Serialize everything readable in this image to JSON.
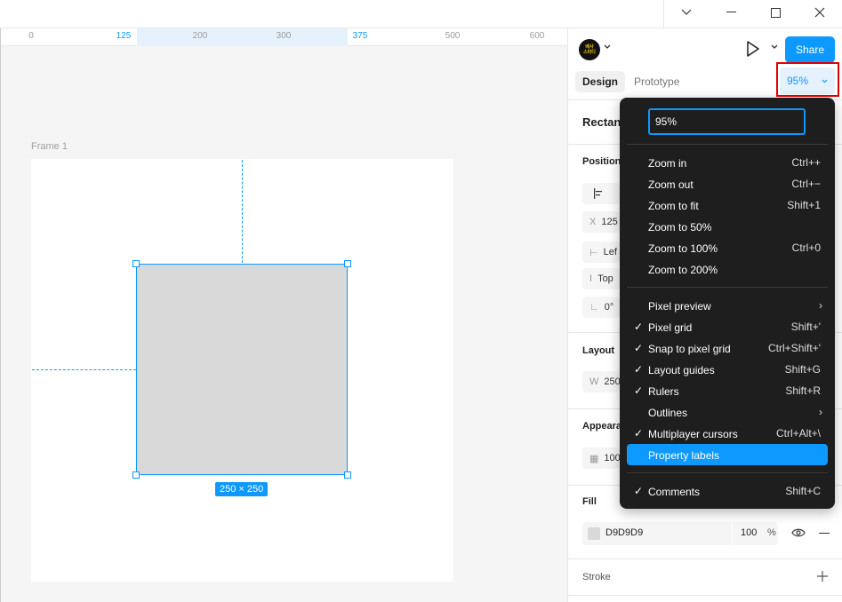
{
  "ruler": {
    "ticks": [
      {
        "label": "0",
        "selected": false
      },
      {
        "label": "125",
        "selected": true
      },
      {
        "label": "200",
        "selected": false
      },
      {
        "label": "300",
        "selected": false
      },
      {
        "label": "375",
        "selected": true
      },
      {
        "label": "500",
        "selected": false
      },
      {
        "label": "600",
        "selected": false
      }
    ]
  },
  "canvas": {
    "frame_label": "Frame 1",
    "dimensions_badge": "250 × 250"
  },
  "avatar": {
    "line1": "배사",
    "line2": "스타디"
  },
  "toolbar": {
    "share_label": "Share",
    "zoom_value": "95%"
  },
  "tabs": [
    {
      "label": "Design",
      "active": true
    },
    {
      "label": "Prototype",
      "active": false
    }
  ],
  "properties": {
    "selection_title": "Rectan",
    "position_label": "Position",
    "x_label": "X",
    "x_value": "125",
    "horizontal_constraint": "Lef",
    "vertical_constraint": "Top",
    "rotation": "0°",
    "layout_label": "Layout",
    "w_label": "W",
    "w_value": "250",
    "appearance_label": "Appeara",
    "opacity": "100",
    "fill_label": "Fill",
    "fill_hex": "D9D9D9",
    "fill_opacity": "100",
    "fill_opacity_unit": "%",
    "stroke_label": "Stroke"
  },
  "zoom_menu": {
    "input_value": "95%",
    "groups": [
      [
        {
          "label": "Zoom in",
          "shortcut": "Ctrl++"
        },
        {
          "label": "Zoom out",
          "shortcut": "Ctrl+−"
        },
        {
          "label": "Zoom to fit",
          "shortcut": "Shift+1"
        },
        {
          "label": "Zoom to 50%",
          "shortcut": ""
        },
        {
          "label": "Zoom to 100%",
          "shortcut": "Ctrl+0"
        },
        {
          "label": "Zoom to 200%",
          "shortcut": ""
        }
      ],
      [
        {
          "label": "Pixel preview",
          "shortcut": "",
          "checked": false,
          "submenu": true
        },
        {
          "label": "Pixel grid",
          "shortcut": "Shift+'",
          "checked": true
        },
        {
          "label": "Snap to pixel grid",
          "shortcut": "Ctrl+Shift+'",
          "checked": true
        },
        {
          "label": "Layout guides",
          "shortcut": "Shift+G",
          "checked": true
        },
        {
          "label": "Rulers",
          "shortcut": "Shift+R",
          "checked": true
        },
        {
          "label": "Outlines",
          "shortcut": "",
          "checked": false,
          "submenu": true
        },
        {
          "label": "Multiplayer cursors",
          "shortcut": "Ctrl+Alt+\\",
          "checked": true
        },
        {
          "label": "Property labels",
          "shortcut": "",
          "checked": false,
          "highlighted": true
        }
      ],
      [
        {
          "label": "Comments",
          "shortcut": "Shift+C",
          "checked": true
        }
      ]
    ]
  },
  "colors": {
    "accent": "#0d99ff",
    "menu_bg": "#1e1e1e",
    "rect_fill": "#d9d9d9",
    "annotation_red": "#e00000"
  },
  "icons": [
    "minimize-icon",
    "maximize-icon",
    "close-icon",
    "chevron-down-icon",
    "play-icon",
    "eye-icon",
    "minus-icon",
    "plus-icon",
    "check-icon",
    "chevron-right-icon"
  ]
}
